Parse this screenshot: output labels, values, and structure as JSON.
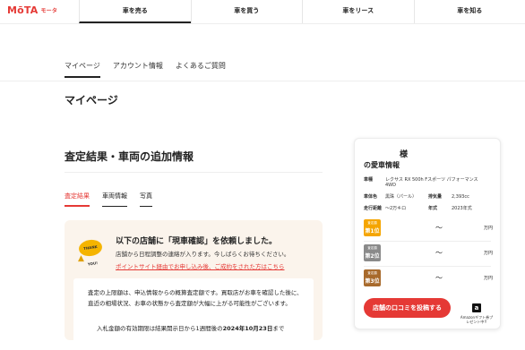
{
  "header": {
    "logo": "MōTA",
    "logo_sub": "モータ",
    "nav": [
      "車を売る",
      "車を買う",
      "車をリース",
      "車を知る"
    ]
  },
  "subnav": [
    "マイページ",
    "アカウント情報",
    "よくあるご質問"
  ],
  "page_title": "マイページ",
  "section_title": "査定結果・車両の追加情報",
  "tabs": [
    "査定結果",
    "車両情報",
    "写真"
  ],
  "notice": {
    "badge": "THANK YOU!",
    "title": "以下の店舗に「現車確認」を依頼しました。",
    "body": "店舗から日程調整の連絡が入ります。今しばらくお待ちください。",
    "link": "ポイントサイト経由でお申し込み後、ご成約をされた方はこちら",
    "info_p1": "査定の上限額は、申込情報からの概算査定額です。買取店がお車を確認した後に、直近の相場状況、お車の状態から査定額が大幅に上がる可能性がございます。",
    "info_p2_prefix": "入札金額の有効期限は結果開示日から1週間後の",
    "info_p2_date": "2024年10月23日",
    "info_p2_suffix": "まで"
  },
  "card": {
    "sama": "様",
    "title": "の愛車情報",
    "specs": {
      "model_label": "車種",
      "model_value": "レクサス RX 500h Fスポーツ パフォーマンス 4WD",
      "color_label": "車体色",
      "color_value": "黒珠（パール）",
      "displacement_label": "排気量",
      "displacement_value": "2,393cc",
      "mileage_label": "走行距離",
      "mileage_value": "〜2万キロ",
      "year_label": "年式",
      "year_value": "2023年式"
    },
    "ranks": [
      {
        "label": "査定額",
        "rank": "第1位",
        "tilde": "〜",
        "yen": "万円"
      },
      {
        "label": "査定額",
        "rank": "第2位",
        "tilde": "〜",
        "yen": "万円"
      },
      {
        "label": "査定額",
        "rank": "第3位",
        "tilde": "〜",
        "yen": "万円"
      }
    ],
    "rank_colors": [
      "#f5a500",
      "#8a8a8a",
      "#a86a2c"
    ],
    "post_button": "店舗の口コミを投稿する",
    "amazon_icon": "a",
    "amazon_text": "Amazonギフト券プレゼント中!!"
  },
  "colors": {
    "accent": "#e53935"
  }
}
